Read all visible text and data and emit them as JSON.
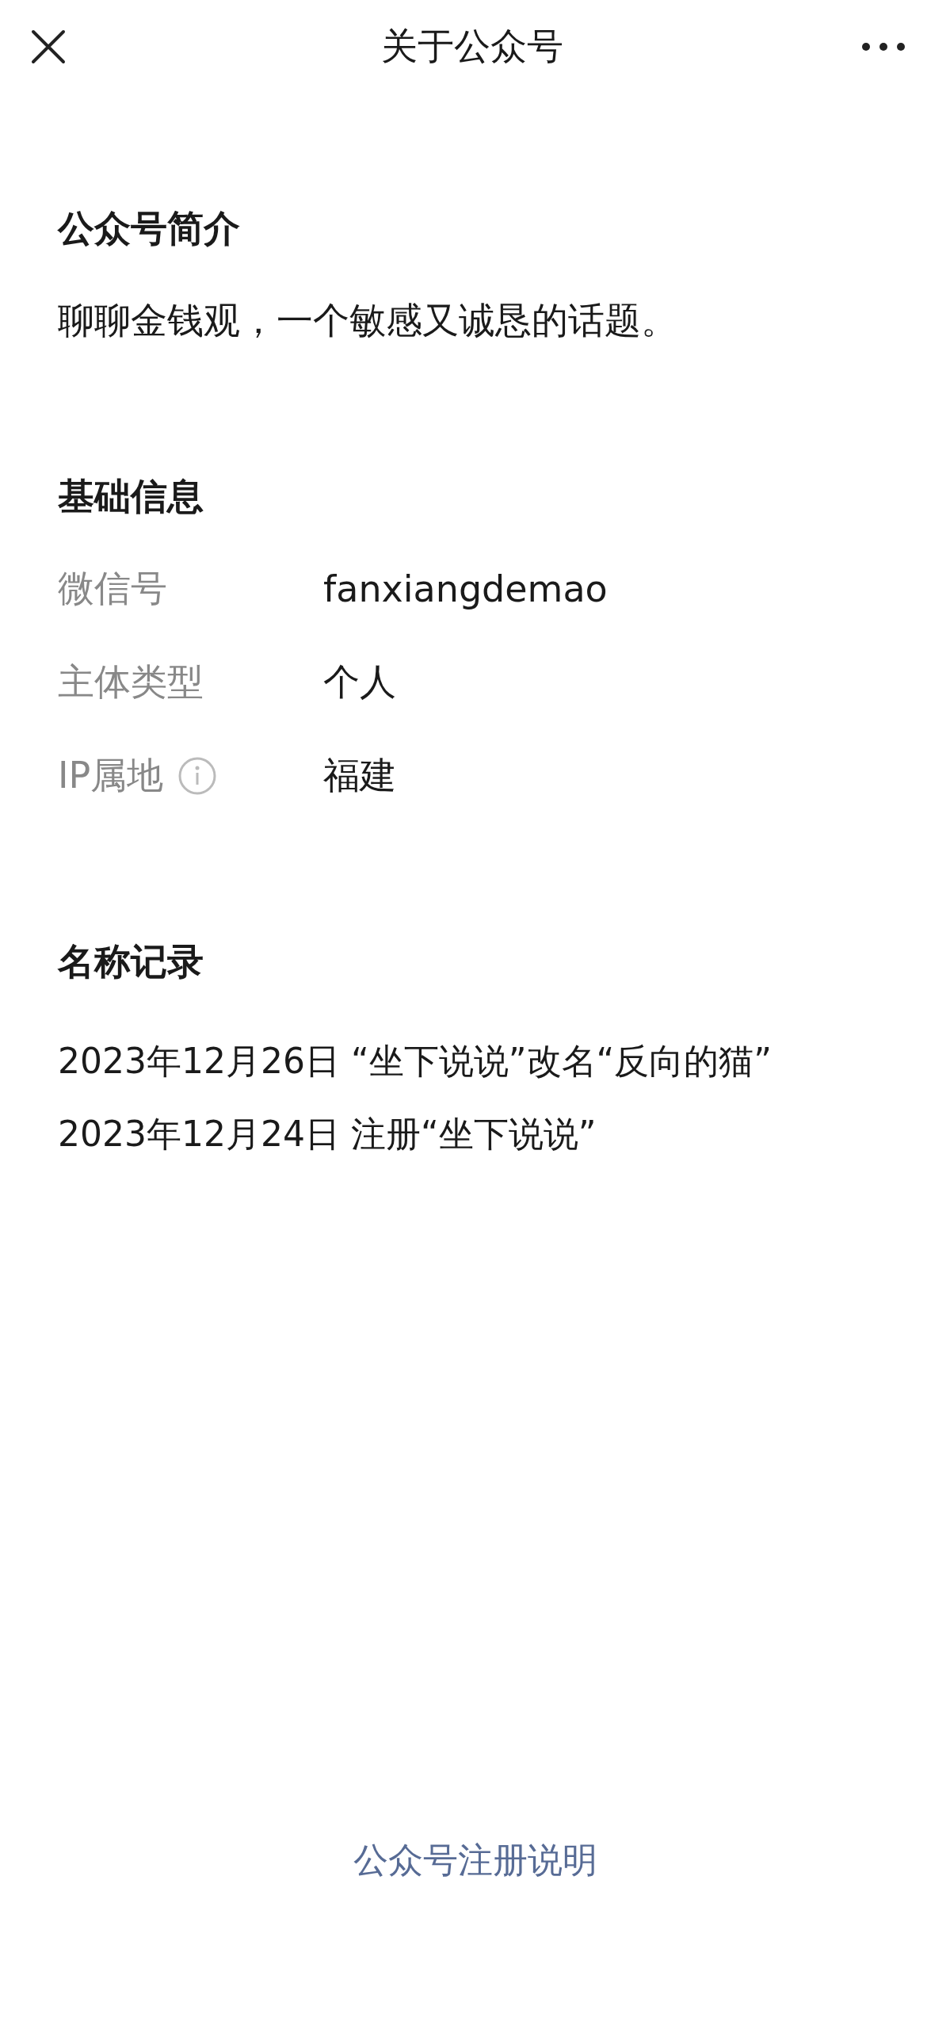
{
  "nav": {
    "title": "关于公众号"
  },
  "intro": {
    "heading": "公众号简介",
    "text": "聊聊金钱观，一个敏感又诚恳的话题。"
  },
  "basic_info": {
    "heading": "基础信息",
    "rows": [
      {
        "label": "微信号",
        "value": "fanxiangdemao",
        "info_icon": false
      },
      {
        "label": "主体类型",
        "value": "个人",
        "info_icon": false
      },
      {
        "label": "IP属地",
        "value": "福建",
        "info_icon": true
      }
    ]
  },
  "name_history": {
    "heading": "名称记录",
    "records": [
      "2023年12月26日 “坐下说说”改名“反向的猫”",
      "2023年12月24日 注册“坐下说说”"
    ]
  },
  "footer_link": "公众号注册说明"
}
